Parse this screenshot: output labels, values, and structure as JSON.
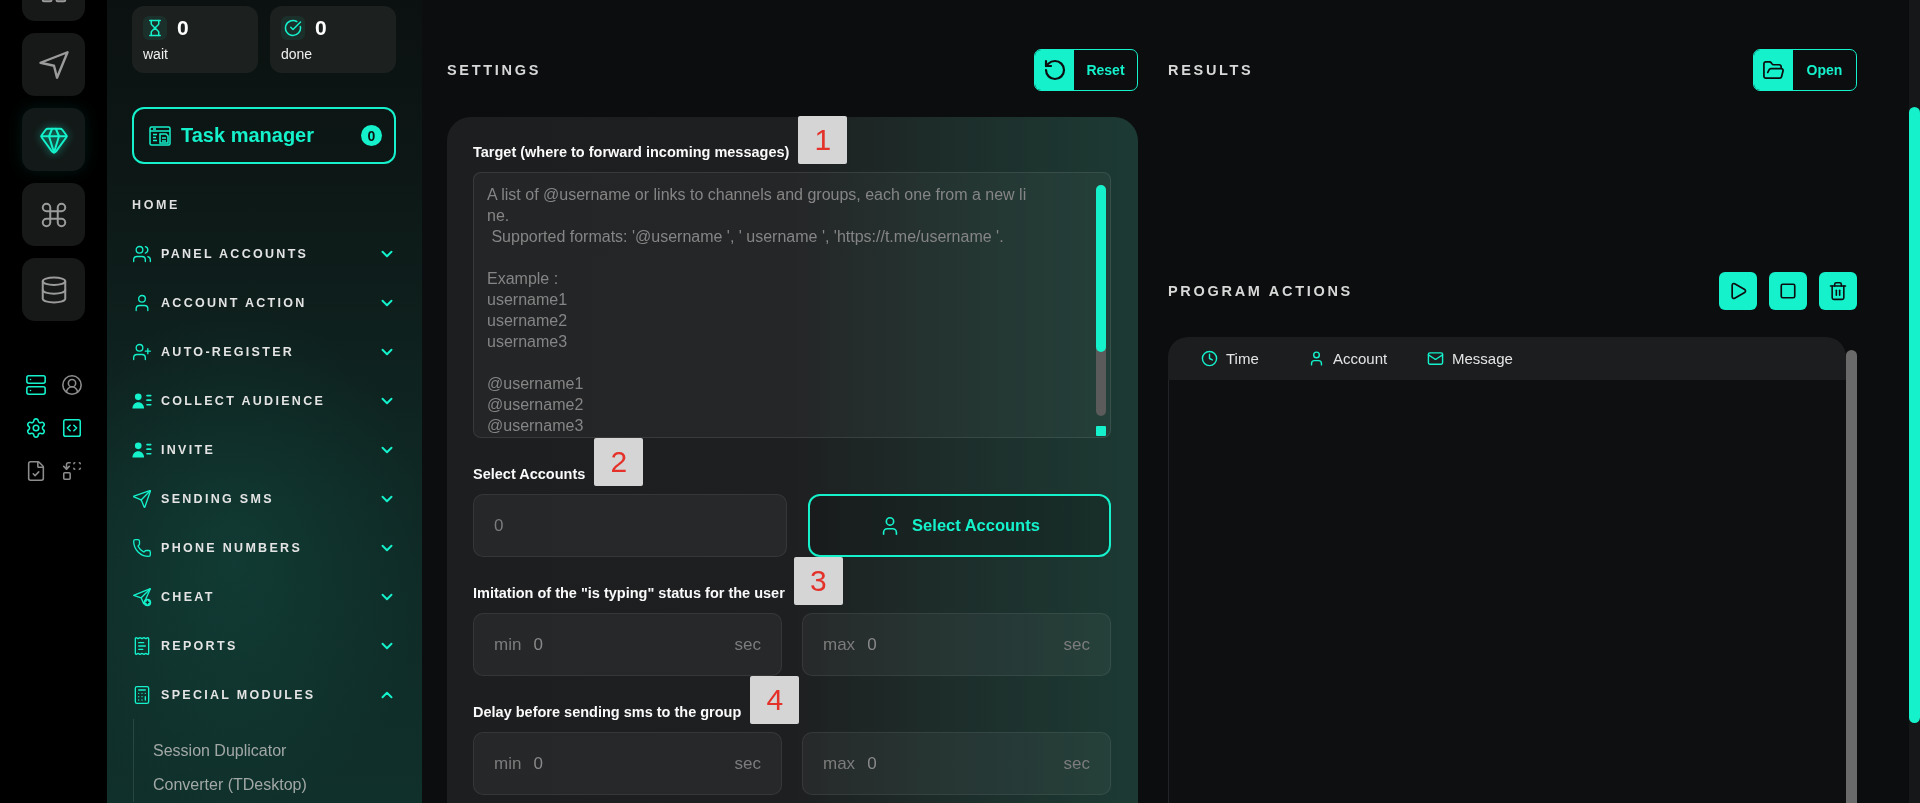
{
  "rail": {
    "items": [
      {
        "selected": false
      },
      {
        "selected": false
      },
      {
        "selected": true
      },
      {
        "selected": false
      },
      {
        "selected": false
      }
    ],
    "tools": [
      {
        "active": true
      },
      {
        "active": false
      },
      {
        "active": true
      },
      {
        "active": true
      },
      {
        "active": false
      },
      {
        "active": false
      }
    ]
  },
  "sidebar": {
    "stats": [
      {
        "value": "0",
        "label": "wait"
      },
      {
        "value": "0",
        "label": "done"
      }
    ],
    "task_manager": {
      "label": "Task manager",
      "count": "0"
    },
    "home": "HOME",
    "nav": [
      {
        "label": "PANEL ACCOUNTS",
        "expanded": false
      },
      {
        "label": "ACCOUNT ACTION",
        "expanded": false
      },
      {
        "label": "AUTO-REGISTER",
        "expanded": false
      },
      {
        "label": "COLLECT AUDIENCE",
        "expanded": false
      },
      {
        "label": "INVITE",
        "expanded": false
      },
      {
        "label": "SENDING SMS",
        "expanded": false
      },
      {
        "label": "PHONE NUMBERS",
        "expanded": false
      },
      {
        "label": "CHEAT",
        "expanded": false
      },
      {
        "label": "REPORTS",
        "expanded": false
      },
      {
        "label": "SPECIAL MODULES",
        "expanded": true,
        "children": [
          {
            "label": "Session Duplicator"
          },
          {
            "label": "Converter (TDesktop)"
          }
        ]
      }
    ]
  },
  "settings": {
    "title": "SETTINGS",
    "reset": "Reset",
    "fields": [
      {
        "kind": "textarea",
        "label": "Target (where to forward incoming messages)",
        "marker": "1",
        "placeholder": "A list of @username or links to channels and groups, each one from a new li\nne.\n Supported formats: '@username ', ' username ', 'https://t.me/username '.\n\nExample :\nusername1\nusername2\nusername3\n\n@username1\n@username2\n@username3"
      },
      {
        "kind": "select",
        "label": "Select Accounts",
        "marker": "2",
        "placeholder": "0",
        "button": "Select Accounts"
      },
      {
        "kind": "range",
        "label": "Imitation of the \"is typing\" status for the user",
        "marker": "3",
        "inputs": [
          {
            "prefix": "min",
            "placeholder": "0",
            "unit": "sec"
          },
          {
            "prefix": "max",
            "placeholder": "0",
            "unit": "sec"
          }
        ]
      },
      {
        "kind": "range",
        "label": "Delay before sending sms to the group",
        "marker": "4",
        "inputs": [
          {
            "prefix": "min",
            "placeholder": "0",
            "unit": "sec"
          },
          {
            "prefix": "max",
            "placeholder": "0",
            "unit": "sec"
          }
        ]
      }
    ]
  },
  "results": {
    "title": "RESULTS",
    "open": "Open"
  },
  "program_actions": {
    "title": "PROGRAM ACTIONS",
    "columns": [
      "Time",
      "Account",
      "Message"
    ]
  }
}
